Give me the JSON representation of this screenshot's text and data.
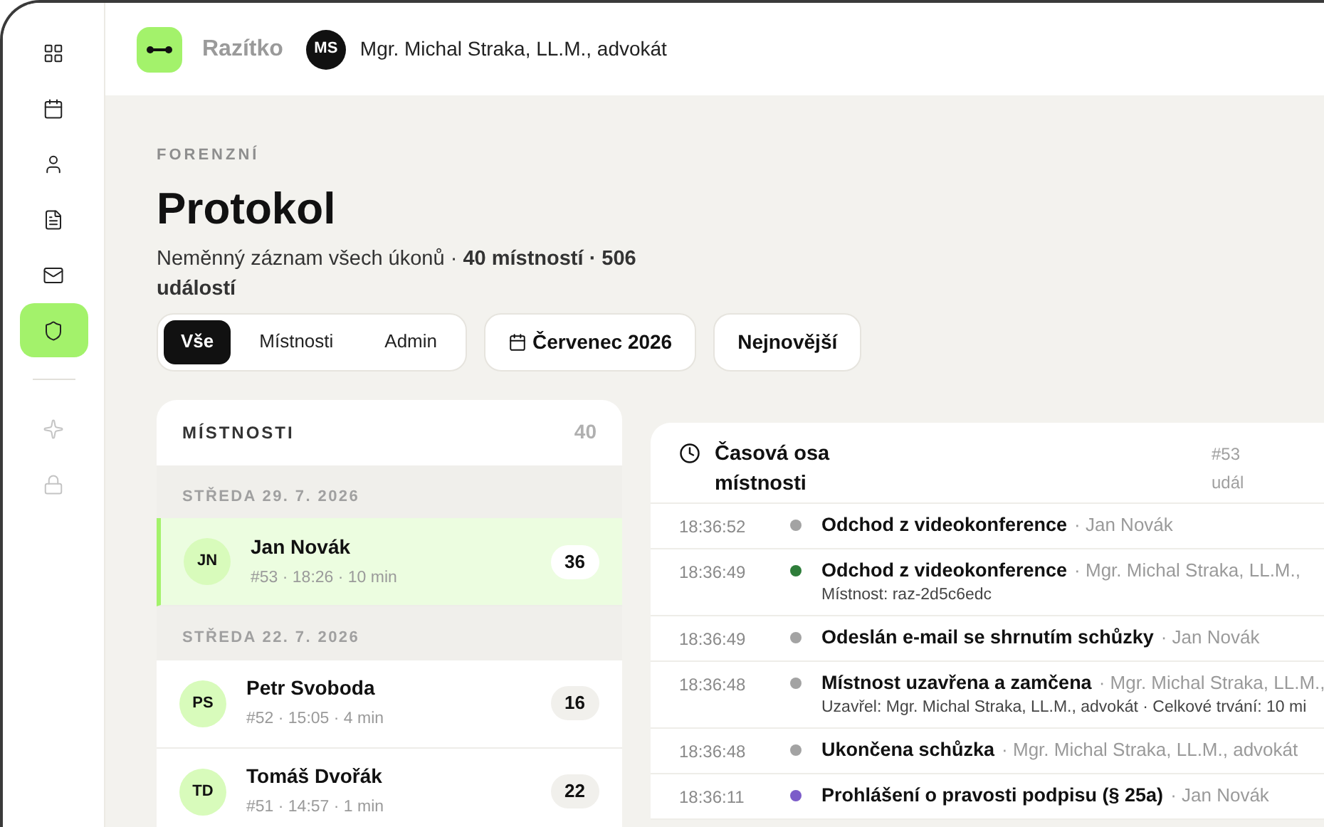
{
  "sidebar": {
    "items": [
      {
        "selected": false,
        "disabled": false
      },
      {
        "selected": false,
        "disabled": false
      },
      {
        "selected": false,
        "disabled": false
      },
      {
        "selected": false,
        "disabled": false
      },
      {
        "selected": false,
        "disabled": false
      },
      {
        "selected": true,
        "disabled": false
      },
      {
        "selected": false,
        "disabled": true
      },
      {
        "selected": false,
        "disabled": true
      }
    ]
  },
  "topbar": {
    "brand": "Razítko",
    "user_initials": "MS",
    "user_name": "Mgr. Michal Straka, LL.M., advokát"
  },
  "page": {
    "eyebrow": "FORENZNÍ",
    "title": "Protokol",
    "subtitle": "Neměnný záznam všech úkonů · **40 místností · 506 událostí**"
  },
  "tabs": [
    {
      "label": "Vše",
      "selected": true
    },
    {
      "label": "Místnosti",
      "selected": false
    },
    {
      "label": "Admin",
      "selected": false
    }
  ],
  "month_button": "Červenec 2026",
  "sort_button": "Nejnovější",
  "rooms": {
    "title": "MÍSTNOSTI",
    "count": "40",
    "groups": [
      {
        "date": "STŘEDA 29. 7. 2026",
        "items": [
          {
            "initials": "JN",
            "name": "Jan Novák",
            "meta": "#53 · 18:26 · 10 min",
            "count": "36",
            "selected": true
          }
        ]
      },
      {
        "date": "STŘEDA 22. 7. 2026",
        "items": [
          {
            "initials": "PS",
            "name": "Petr Svoboda",
            "meta": "#52 · 15:05 · 4 min",
            "count": "16",
            "selected": false
          },
          {
            "initials": "TD",
            "name": "Tomáš Dvořák",
            "meta": "#51 · 14:57 · 1 min",
            "count": "22",
            "selected": false
          }
        ]
      }
    ]
  },
  "timeline": {
    "title": "Časová osa místnosti",
    "ref": "#53",
    "ref_sub": "udál",
    "events": [
      {
        "time": "18:36:52",
        "color": "#a3a3a3",
        "title": "Odchod z videokonference",
        "actor": "· Jan Novák"
      },
      {
        "time": "18:36:49",
        "color": "#2e7d3a",
        "title": "Odchod z videokonference",
        "actor": "· Mgr. Michal Straka, LL.M.,",
        "detail": "Místnost: raz-2d5c6edc"
      },
      {
        "time": "18:36:49",
        "color": "#a3a3a3",
        "title": "Odeslán e-mail se shrnutím schůzky",
        "actor": "· Jan Novák"
      },
      {
        "time": "18:36:48",
        "color": "#a3a3a3",
        "title": "Místnost uzavřena a zamčena",
        "actor": "· Mgr. Michal Straka, LL.M.,",
        "detail": "Uzavřel: Mgr. Michal Straka, LL.M., advokát · Celkové trvání: 10 mi"
      },
      {
        "time": "18:36:48",
        "color": "#a3a3a3",
        "title": "Ukončena schůzka",
        "actor": "· Mgr. Michal Straka, LL.M., advokát"
      },
      {
        "time": "18:36:11",
        "color": "#7c5cc9",
        "title": "Prohlášení o pravosti podpisu (§ 25a)",
        "actor": "· Jan Novák"
      }
    ]
  }
}
